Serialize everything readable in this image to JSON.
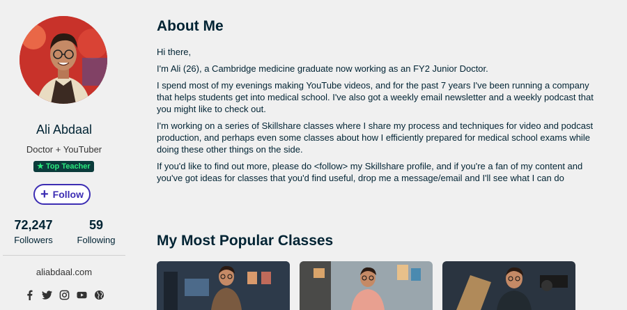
{
  "profile": {
    "name": "Ali Abdaal",
    "role": "Doctor + YouTuber",
    "badge": "★ Top Teacher",
    "follow_label": "Follow",
    "followers_count": "72,247",
    "followers_label": "Followers",
    "following_count": "59",
    "following_label": "Following",
    "website": "aliabdaal.com",
    "socials": [
      "facebook-icon",
      "twitter-icon",
      "instagram-icon",
      "youtube-icon",
      "globe-icon"
    ]
  },
  "about": {
    "heading": "About Me",
    "paragraphs": [
      "Hi there,",
      "I'm Ali (26), a Cambridge medicine graduate now working as an FY2 Junior Doctor.",
      "I spend most of my evenings making YouTube videos, and for the past 7 years I've been running a company that helps students get into medical school. I've also got a weekly email newsletter and a weekly podcast that you might like to check out.",
      "I'm working on a series of Skillshare classes where I share my process and techniques for video and podcast production, and perhaps even some classes about how I efficiently prepared for medical school exams while doing these other things on the side.",
      "If you'd like to find out more, please do <follow> my Skillshare profile, and if you're a fan of my content and you've got ideas for classes that you'd find useful, drop me a message/email and I'll see what I can do"
    ]
  },
  "classes": {
    "heading": "My Most Popular Classes"
  },
  "colors": {
    "accent": "#3c2db3",
    "badge_bg": "#0b3b3b",
    "badge_text": "#2bea7e",
    "text": "#002333",
    "background": "#f0f0f0"
  }
}
